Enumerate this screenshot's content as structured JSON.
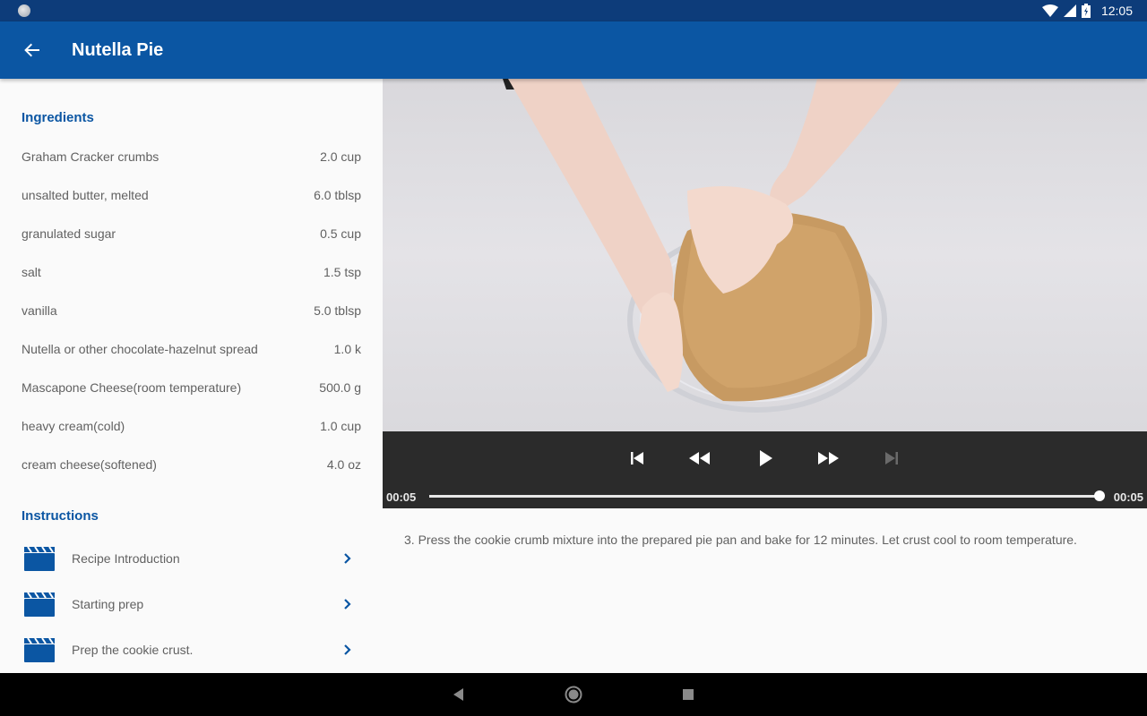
{
  "status_bar": {
    "time": "12:05"
  },
  "app_bar": {
    "title": "Nutella Pie"
  },
  "ingredients": {
    "heading": "Ingredients",
    "items": [
      {
        "name": "Graham Cracker crumbs",
        "qty": "2.0 cup"
      },
      {
        "name": "unsalted butter, melted",
        "qty": "6.0 tblsp"
      },
      {
        "name": "granulated sugar",
        "qty": "0.5 cup"
      },
      {
        "name": "salt",
        "qty": "1.5 tsp"
      },
      {
        "name": "vanilla",
        "qty": "5.0 tblsp"
      },
      {
        "name": "Nutella or other chocolate-hazelnut spread",
        "qty": "1.0 k"
      },
      {
        "name": "Mascapone Cheese(room temperature)",
        "qty": "500.0 g"
      },
      {
        "name": "heavy cream(cold)",
        "qty": "1.0 cup"
      },
      {
        "name": "cream cheese(softened)",
        "qty": "4.0 oz"
      }
    ]
  },
  "instructions": {
    "heading": "Instructions",
    "items": [
      {
        "label": "Recipe Introduction"
      },
      {
        "label": "Starting prep"
      },
      {
        "label": "Prep the cookie crust."
      }
    ]
  },
  "player": {
    "position": "00:05",
    "duration": "00:05",
    "progress": 1.0
  },
  "step": {
    "text": "3. Press the cookie crumb mixture into the prepared pie pan and bake for 12 minutes. Let crust cool to room temperature."
  },
  "colors": {
    "primary": "#0b56a3",
    "status_bar": "#0d3c7a",
    "player_bg": "#2b2b2b"
  }
}
